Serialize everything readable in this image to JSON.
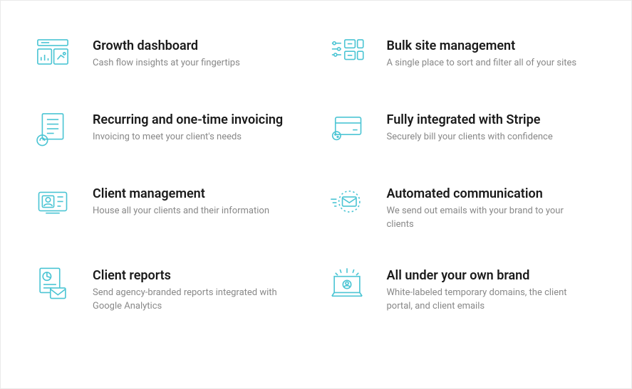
{
  "features": [
    {
      "title": "Growth dashboard",
      "desc": "Cash flow insights at your fingertips"
    },
    {
      "title": "Bulk site management",
      "desc": "A single place to sort and filter all of your sites"
    },
    {
      "title": "Recurring and one-time invoicing",
      "desc": "Invoicing to meet your client's needs"
    },
    {
      "title": "Fully integrated with Stripe",
      "desc": "Securely bill your clients with confidence"
    },
    {
      "title": "Client management",
      "desc": "House all your clients and their information"
    },
    {
      "title": "Automated communication",
      "desc": "We send out emails with your brand to your clients"
    },
    {
      "title": "Client reports",
      "desc": "Send agency-branded reports integrated with Google Analytics"
    },
    {
      "title": "All under your own brand",
      "desc": "White-labeled temporary domains, the client portal, and client emails"
    }
  ]
}
